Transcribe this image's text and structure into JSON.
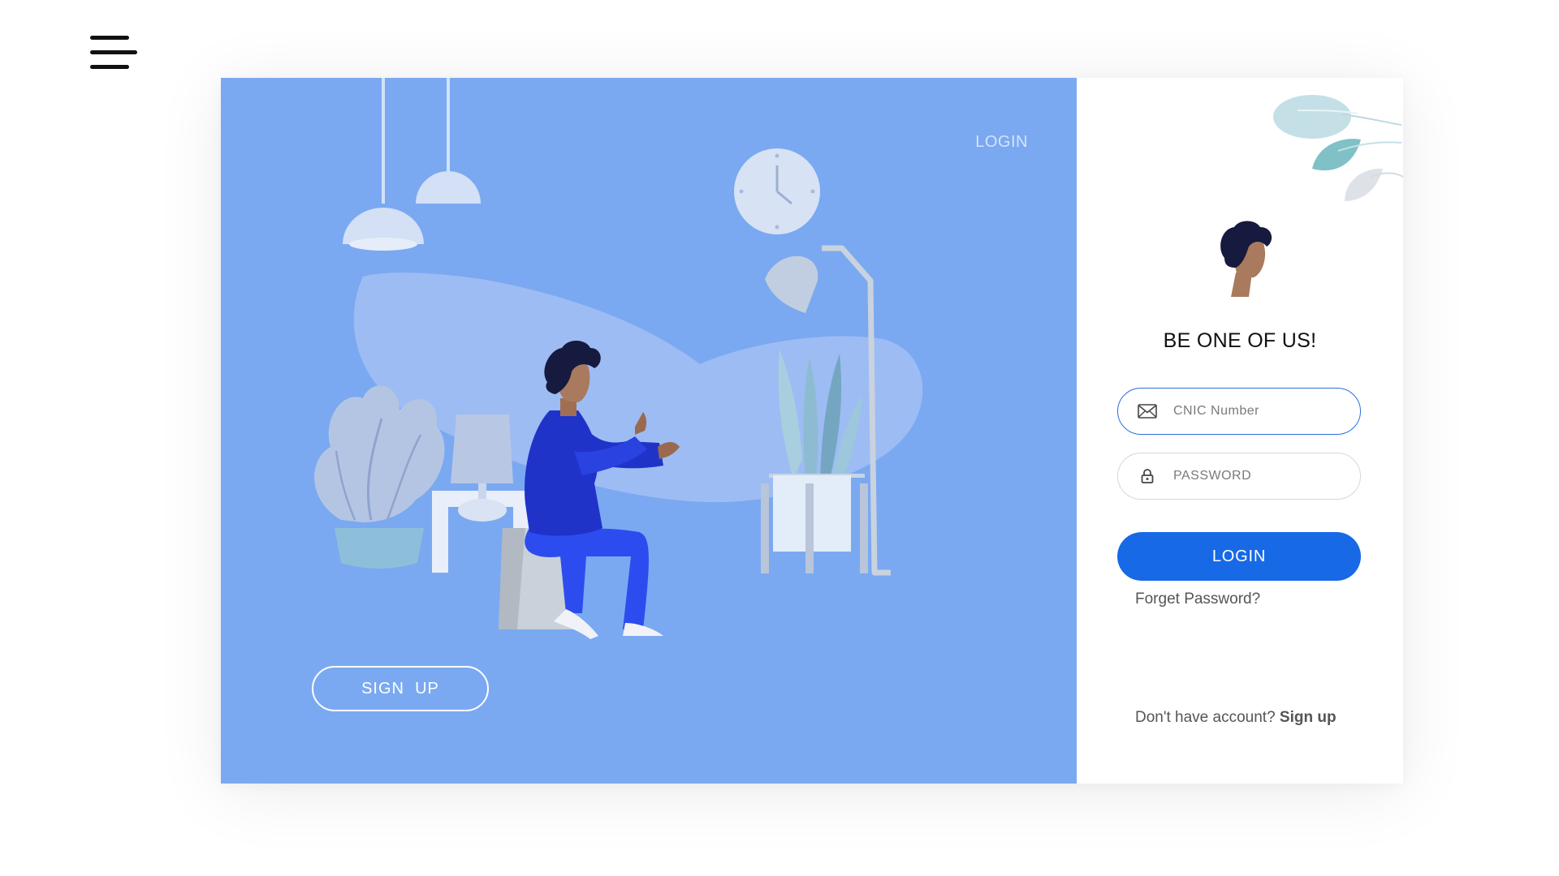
{
  "menu": {
    "icon": "hamburger-menu-icon"
  },
  "left_panel": {
    "top_login_label": "LOGIN",
    "signup_button_label": "SIGN  UP",
    "background_color": "#7aa9f1"
  },
  "right_panel": {
    "tagline": "BE ONE OF US!",
    "cnic_field": {
      "placeholder": "CNIC Number",
      "value": "",
      "icon": "envelope-icon"
    },
    "password_field": {
      "placeholder": "PASSWORD",
      "value": "",
      "icon": "lock-icon"
    },
    "login_button_label": "LOGIN",
    "forgot_password_label": "Forget Password?",
    "signup_prompt_text": "Don't have account?",
    "signup_link_label": "Sign up"
  },
  "colors": {
    "accent": "#1769e6",
    "focus_border": "#2b6fe0",
    "panel_blue": "#7aa9f1"
  }
}
